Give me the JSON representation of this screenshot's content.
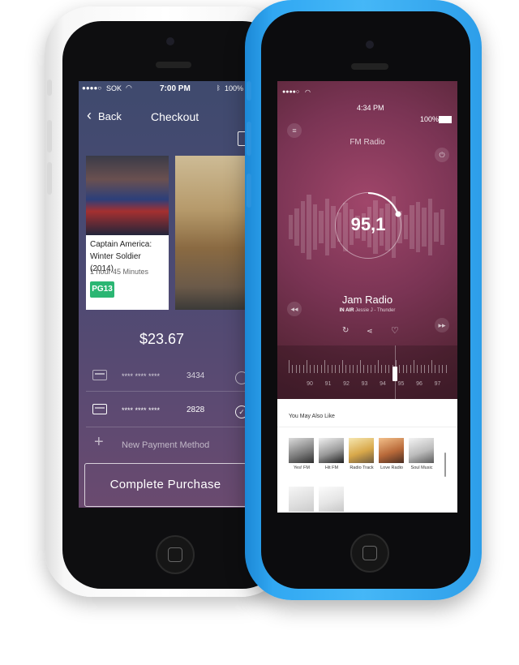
{
  "checkout_phone": {
    "status": {
      "carrier": "SOK",
      "time": "7:00 PM",
      "battery": "100%"
    },
    "nav": {
      "back_label": "Back",
      "title": "Checkout"
    },
    "movie": {
      "title": "Captain America: Winter Soldier (2014)",
      "duration": "1 hour 45 Minutes",
      "rating": "PG13"
    },
    "total": "$23.67",
    "payment_methods": [
      {
        "masked": "**** **** ****",
        "last4": "3434",
        "selected": false
      },
      {
        "masked": "**** **** ****",
        "last4": "2828",
        "selected": true
      }
    ],
    "new_payment_label": "New Payment Method",
    "complete_button": "Complete Purchase"
  },
  "radio_phone": {
    "status": {
      "time": "4:34 PM",
      "battery": "100%"
    },
    "header_title": "FM Radio",
    "frequency": "95,1",
    "station_name": "Jam Radio",
    "on_air_label": "IN AIR",
    "now_playing": "Jessie J - Thunder",
    "tuner_labels": [
      "90",
      "91",
      "92",
      "93",
      "94",
      "95",
      "96",
      "97"
    ],
    "suggestions_title": "You May Also Like",
    "suggestions": [
      {
        "label": "Yes! FM"
      },
      {
        "label": "Hit FM"
      },
      {
        "label": "Radio Track"
      },
      {
        "label": "Love Radio"
      },
      {
        "label": "Soul Music"
      }
    ]
  },
  "colors": {
    "accent_green": "#2bb673",
    "phone_blue": "#45b7f7",
    "radio_bg": "#7a3454"
  }
}
